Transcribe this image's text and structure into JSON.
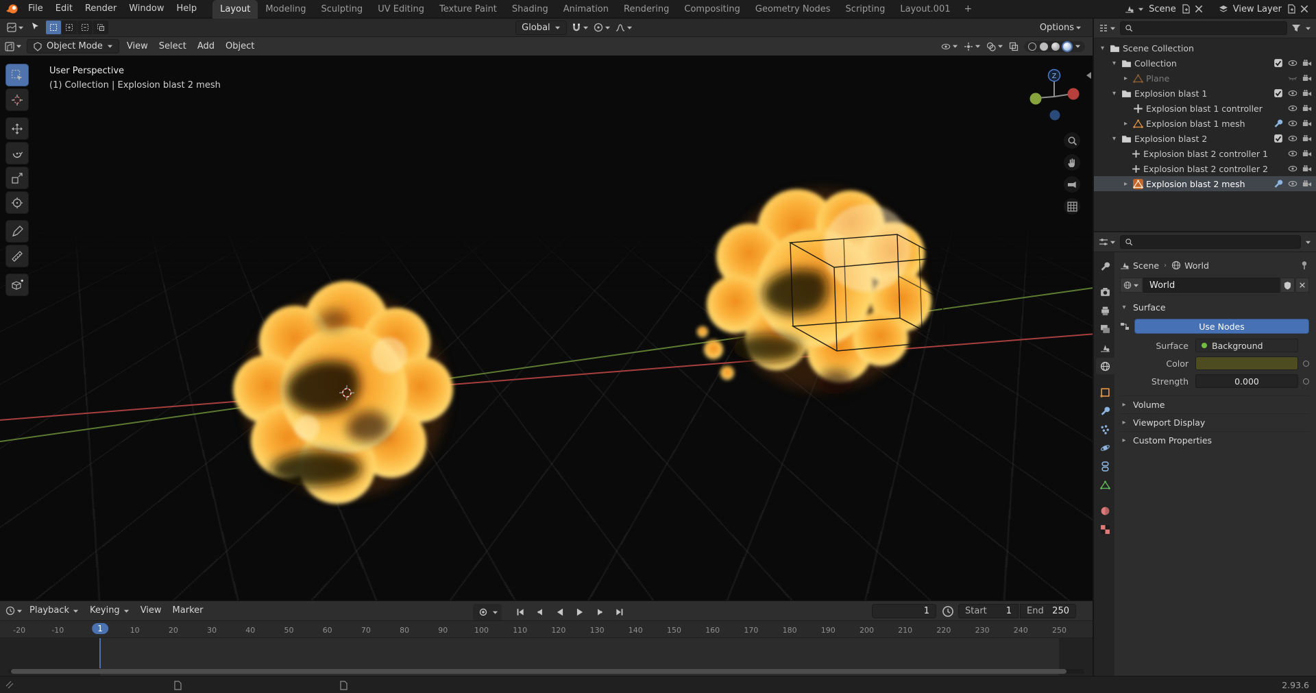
{
  "topbar": {
    "menus": [
      "File",
      "Edit",
      "Render",
      "Window",
      "Help"
    ],
    "tabs": [
      "Layout",
      "Modeling",
      "Sculpting",
      "UV Editing",
      "Texture Paint",
      "Shading",
      "Animation",
      "Rendering",
      "Compositing",
      "Geometry Nodes",
      "Scripting",
      "Layout.001"
    ],
    "active_tab": "Layout",
    "add_tab_label": "+",
    "scene_label": "Scene",
    "view_layer_label": "View Layer"
  },
  "tool_settings": {
    "orientation": "Global",
    "options_label": "Options"
  },
  "viewport": {
    "mode": "Object Mode",
    "header_menus": [
      "View",
      "Select",
      "Add",
      "Object"
    ],
    "overlay_line1": "User Perspective",
    "overlay_line2": "(1) Collection | Explosion blast 2 mesh",
    "gizmo_z_label": "Z",
    "scene_objects": [
      "Explosion blast 1",
      "Explosion blast 2"
    ]
  },
  "toolbar": {
    "tools": [
      {
        "name": "tweak-select-tool",
        "icon": "tool-select",
        "active": true
      },
      {
        "name": "cursor-tool",
        "icon": "tool-cursor"
      },
      {
        "name": "move-tool",
        "icon": "tool-move",
        "gap": true
      },
      {
        "name": "rotate-tool",
        "icon": "tool-rotate"
      },
      {
        "name": "scale-tool",
        "icon": "tool-scale"
      },
      {
        "name": "transform-tool",
        "icon": "tool-transform"
      },
      {
        "name": "annotate-tool",
        "icon": "tool-annotate",
        "gap": true
      },
      {
        "name": "measure-tool",
        "icon": "tool-measure"
      },
      {
        "name": "add-cube-tool",
        "icon": "tool-addcube",
        "gap": true
      }
    ]
  },
  "outliner": {
    "rows": [
      {
        "label": "Scene Collection",
        "depth": 0,
        "icon": "collection",
        "expander": "open",
        "right": []
      },
      {
        "label": "Collection",
        "depth": 1,
        "icon": "collection",
        "expander": "open",
        "right": [
          "checkbox",
          "eye",
          "camera"
        ]
      },
      {
        "label": "Plane",
        "depth": 2,
        "icon": "mesh",
        "muted": true,
        "expander": "closed",
        "right": [
          "eye-closed",
          "camera"
        ]
      },
      {
        "label": "Explosion blast 1",
        "depth": 1,
        "icon": "collection",
        "expander": "open",
        "right": [
          "checkbox",
          "eye",
          "camera"
        ]
      },
      {
        "label": "Explosion blast 1 controller",
        "depth": 2,
        "icon": "empty",
        "right": [
          "eye",
          "camera"
        ]
      },
      {
        "label": "Explosion blast 1 mesh",
        "depth": 2,
        "icon": "mesh",
        "expander": "closed",
        "right": [
          "modifier",
          "eye",
          "camera"
        ]
      },
      {
        "label": "Explosion blast 2",
        "depth": 1,
        "icon": "collection",
        "expander": "open",
        "right": [
          "checkbox",
          "eye",
          "camera"
        ]
      },
      {
        "label": "Explosion blast 2 controller 1",
        "depth": 2,
        "icon": "empty",
        "right": [
          "eye",
          "camera"
        ]
      },
      {
        "label": "Explosion blast 2 controller 2",
        "depth": 2,
        "icon": "empty",
        "right": [
          "eye",
          "camera"
        ]
      },
      {
        "label": "Explosion blast 2 mesh",
        "depth": 2,
        "icon": "mesh",
        "selected": true,
        "expander": "closed",
        "right": [
          "modifier",
          "eye",
          "camera"
        ]
      }
    ]
  },
  "properties": {
    "active_tab": "world",
    "tabs": [
      {
        "name": "tool",
        "color": "#b5b5b5"
      },
      {
        "name": "render",
        "color": "#b5b5b5",
        "gap": true
      },
      {
        "name": "output",
        "color": "#b5b5b5"
      },
      {
        "name": "view-layer",
        "color": "#b5b5b5"
      },
      {
        "name": "scene",
        "color": "#b5b5b5"
      },
      {
        "name": "world",
        "color": "#cccccc"
      },
      {
        "name": "object",
        "color": "#e0903f",
        "gap": true
      },
      {
        "name": "modifiers",
        "color": "#8cb4dd"
      },
      {
        "name": "particles",
        "color": "#8cb4dd"
      },
      {
        "name": "physics",
        "color": "#8cb4dd"
      },
      {
        "name": "constraints",
        "color": "#8cb4dd"
      },
      {
        "name": "object-data",
        "color": "#5fba59"
      },
      {
        "name": "material",
        "color": "#e07a7a",
        "gap": true
      },
      {
        "name": "texture",
        "color": "#e07a7a"
      }
    ],
    "breadcrumb_scene": "Scene",
    "breadcrumb_world": "World",
    "datablock_name": "World",
    "surface_title": "Surface",
    "use_nodes_label": "Use Nodes",
    "surface_label": "Surface",
    "surface_value": "Background",
    "color_label": "Color",
    "color_value": "#4c4c20",
    "strength_label": "Strength",
    "strength_value": "0.000",
    "panels_collapsed": [
      "Volume",
      "Viewport Display",
      "Custom Properties"
    ]
  },
  "timeline": {
    "menus": [
      {
        "label": "Playback",
        "caret": true
      },
      {
        "label": "Keying",
        "caret": true
      },
      {
        "label": "View",
        "caret": false
      },
      {
        "label": "Marker",
        "caret": false
      }
    ],
    "current_frame": "1",
    "frame_start": 1,
    "frame_end": 250,
    "start_label": "Start",
    "start_value": "1",
    "end_label": "End",
    "end_value": "250",
    "ticks": [
      -20,
      -10,
      10,
      20,
      30,
      40,
      50,
      60,
      70,
      80,
      90,
      100,
      110,
      120,
      130,
      140,
      150,
      160,
      170,
      180,
      190,
      200,
      210,
      220,
      230,
      240,
      250
    ]
  },
  "statusbar": {
    "version": "2.93.6"
  },
  "colors": {
    "accent_blue": "#4772b3",
    "object_orange": "#e0903f",
    "axis_red": "#a83f3f",
    "axis_green": "#5d7a31",
    "fire_rim": "#ffeb9e",
    "fire_core": "#f29122"
  }
}
